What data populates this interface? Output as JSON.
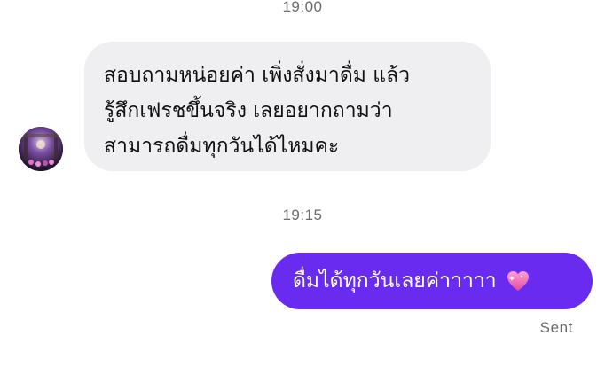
{
  "conversation": {
    "timestamp_1": "19:00",
    "incoming_message": {
      "lines": [
        "สอบถามหน่อยค่า เพิ่งสั่งมาดื่ม แล้ว",
        "รู้สึกเฟรชขึ้นจริง เลยอยากถามว่า",
        "สามารถดื่มทุกวันได้ไหมคะ"
      ]
    },
    "timestamp_2": "19:15",
    "outgoing_message": {
      "text": "ดื่มได้ทุกวันเลยค่าาาาา",
      "emoji": "sparkling-heart-icon"
    },
    "delivery_status": "Sent"
  },
  "colors": {
    "incoming_bubble": "#efeff2",
    "outgoing_bubble": "#6a2bf0",
    "timestamp_text": "#6b6b6b",
    "heart": "#f06fb6"
  }
}
